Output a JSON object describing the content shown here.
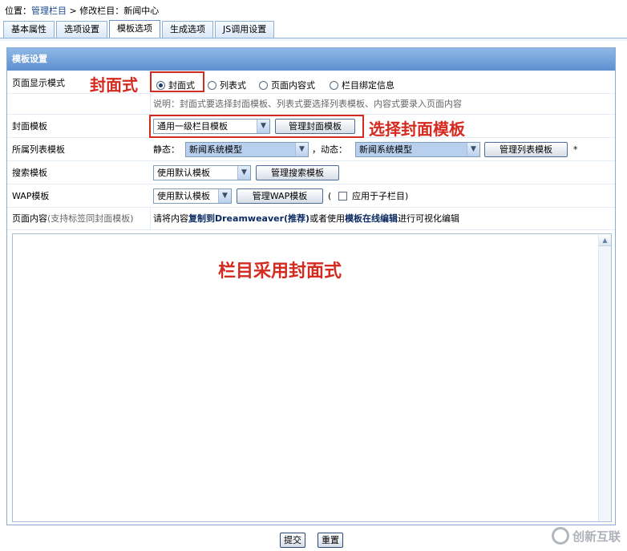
{
  "breadcrumb": {
    "prefix": "位置：",
    "link": "管理栏目",
    "sep": " > ",
    "current": "修改栏目：新闻中心"
  },
  "tabs": [
    "基本属性",
    "选项设置",
    "模板选项",
    "生成选项",
    "JS调用设置"
  ],
  "panel": {
    "title": "模板设置"
  },
  "display_mode": {
    "label": "页面显示模式",
    "options": [
      "封面式",
      "列表式",
      "页面内容式",
      "栏目绑定信息"
    ],
    "selected": "封面式",
    "note": "说明：封面式要选择封面模板、列表式要选择列表模板、内容式要录入页面内容"
  },
  "cover_template": {
    "label": "封面模板",
    "value": "通用一级栏目模板",
    "button": "管理封面模板"
  },
  "list_template": {
    "label": "所属列表模板",
    "static_label": "静态：",
    "static_value": "新闻系统模型",
    "dynamic_label": "，动态：",
    "dynamic_value": "新闻系统模型",
    "button": "管理列表模板",
    "required_mark": "*"
  },
  "search_template": {
    "label": "搜索模板",
    "value": "使用默认模板",
    "button": "管理搜索模板"
  },
  "wap_template": {
    "label": "WAP模板",
    "value": "使用默认模板",
    "button": "管理WAP模板",
    "open_paren": "(",
    "checkbox_label": "应用于子栏目)"
  },
  "page_content": {
    "label": "页面内容",
    "label_note": "(支持标签同封面模板)",
    "text_1": "请将内容",
    "link_1": "复制到Dreamweaver(推荐)",
    "text_2": "或者使用",
    "link_2": "模板在线编辑",
    "text_3": "进行可视化编辑"
  },
  "annotations": {
    "cover_style": "封面式",
    "choose_cover": "选择封面模板",
    "column_uses": "栏目采用封面式"
  },
  "footer": {
    "submit": "提交",
    "reset": "重置"
  },
  "watermark": "创新互联",
  "colors": {
    "annotation": "#d42a1f",
    "panel_header": "#6f9fd8",
    "link": "#0b2b62"
  }
}
